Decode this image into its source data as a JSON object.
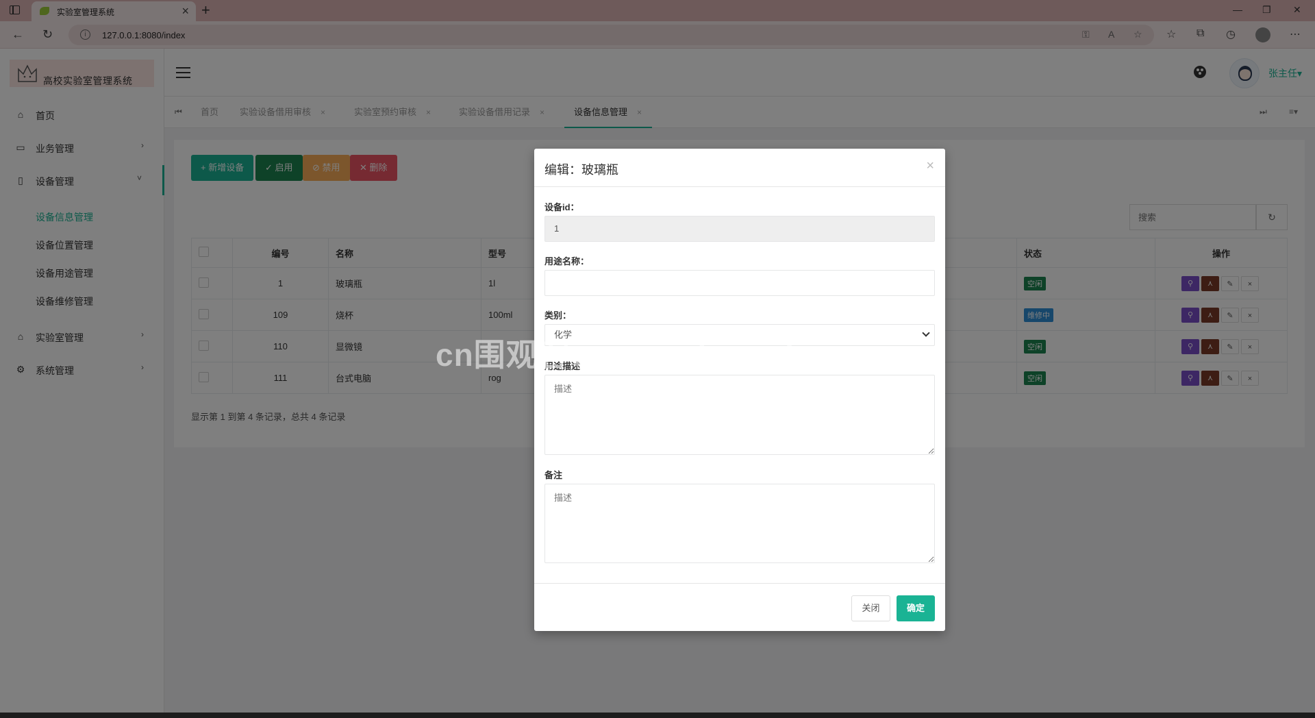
{
  "browser": {
    "tab_title": "实验室管理系统",
    "url": "127.0.0.1:8080/index"
  },
  "sidebar": {
    "logo_text": "高校实验室管理系统",
    "items": [
      {
        "label": "首页",
        "icon": "home-icon"
      },
      {
        "label": "业务管理",
        "icon": "laptop-icon"
      },
      {
        "label": "设备管理",
        "icon": "book-icon"
      },
      {
        "label": "实验室管理",
        "icon": "building-icon"
      },
      {
        "label": "系统管理",
        "icon": "gear-icon"
      }
    ],
    "device_submenu": [
      "设备信息管理",
      "设备位置管理",
      "设备用途管理",
      "设备维修管理"
    ]
  },
  "topbar": {
    "user_name": "张主任▾"
  },
  "page_tabs": [
    {
      "label": "首页"
    },
    {
      "label": "实验设备借用审核"
    },
    {
      "label": "实验室预约审核"
    },
    {
      "label": "实验设备借用记录"
    },
    {
      "label": "设备信息管理"
    }
  ],
  "toolbar": {
    "add_label": "+ 新增设备",
    "enable_label": "✓ 启用",
    "disable_label": "⊘ 禁用",
    "delete_label": "✕ 删除",
    "search_placeholder": "搜索"
  },
  "table": {
    "headers": [
      "编号",
      "名称",
      "型号",
      "状态",
      "操作"
    ],
    "rows": [
      {
        "id": "1",
        "name": "玻璃瓶",
        "model": "1l",
        "status": "空闲"
      },
      {
        "id": "109",
        "name": "烧杯",
        "model": "100ml",
        "status": "维修中"
      },
      {
        "id": "110",
        "name": "显微镜",
        "model": "",
        "status": "空闲"
      },
      {
        "id": "111",
        "name": "台式电脑",
        "model": "rog",
        "status": "空闲"
      }
    ],
    "summary": "显示第 1 到第 4 条记录，总共 4 条记录"
  },
  "modal": {
    "title": "编辑：玻璃瓶",
    "device_id_label": "设备id：",
    "device_id_value": "1",
    "purpose_name_label": "用途名称：",
    "purpose_name_value": "",
    "category_label": "类别：",
    "category_value": "化学",
    "description_label": "用途描述",
    "description_placeholder": "描述",
    "remark_label": "备注",
    "remark_placeholder": "描述",
    "close_label": "关闭",
    "confirm_label": "确定"
  },
  "watermark": "cn围观客www.weiguanke.cn",
  "colors": {
    "accent": "#1ab394",
    "enable": "#1c8450",
    "disable": "#f8ac59",
    "delete": "#ed5565"
  }
}
